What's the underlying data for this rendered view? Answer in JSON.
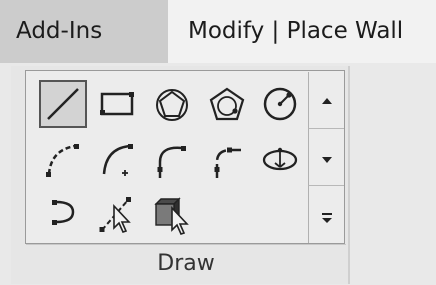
{
  "ribbon": {
    "tabs": [
      {
        "label": "Add-Ins"
      },
      {
        "label": "Modify | Place Wall"
      }
    ]
  },
  "draw_panel": {
    "label": "Draw",
    "tools": [
      {
        "icon": "line-icon",
        "selected": true
      },
      {
        "icon": "rectangle-icon"
      },
      {
        "icon": "inscribed-polygon-icon"
      },
      {
        "icon": "circumscribed-polygon-icon"
      },
      {
        "icon": "circle-icon"
      },
      {
        "icon": "start-end-radius-arc-icon"
      },
      {
        "icon": "center-ends-arc-icon"
      },
      {
        "icon": "tangent-end-arc-icon"
      },
      {
        "icon": "fillet-arc-icon"
      },
      {
        "icon": "ellipse-icon"
      },
      {
        "icon": "partial-ellipse-icon"
      },
      {
        "icon": "pick-lines-icon"
      },
      {
        "icon": "pick-faces-icon"
      }
    ],
    "scroll_icons": [
      "scroll-up-icon",
      "scroll-down-icon",
      "expand-gallery-icon"
    ]
  }
}
